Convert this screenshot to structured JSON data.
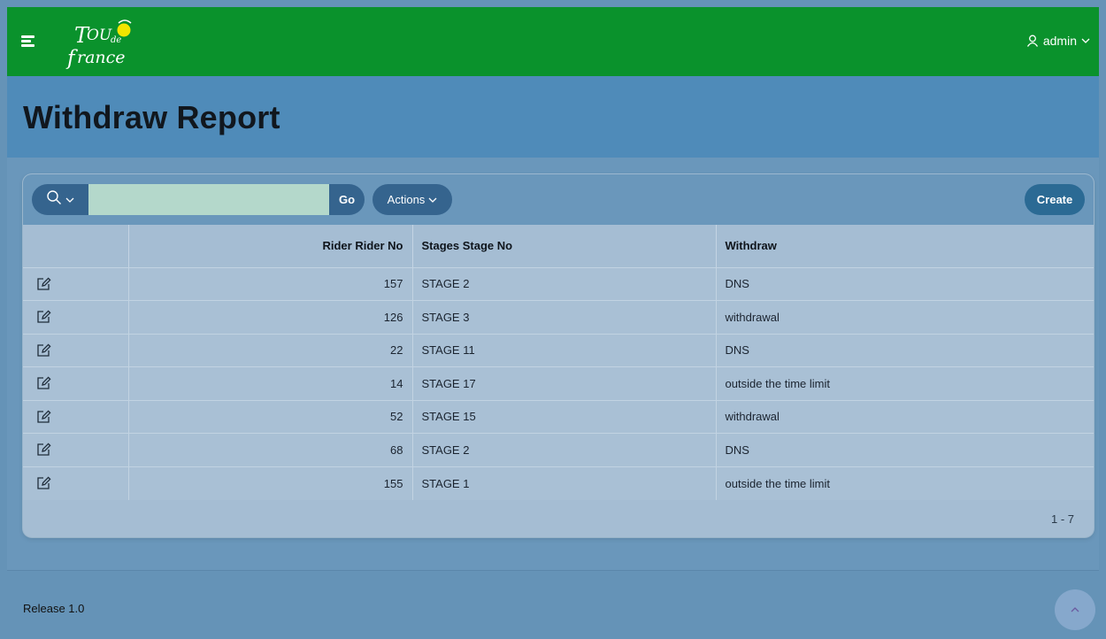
{
  "header": {
    "logo_alt": "Tour de France",
    "user_label": "admin"
  },
  "page": {
    "title": "Withdraw Report"
  },
  "toolbar": {
    "go_label": "Go",
    "actions_label": "Actions",
    "create_label": "Create",
    "search_value": ""
  },
  "table": {
    "columns": [
      "",
      "Rider Rider No",
      "Stages Stage No",
      "Withdraw"
    ],
    "rows": [
      {
        "rider_no": "157",
        "stage": "STAGE 2",
        "withdraw": "DNS"
      },
      {
        "rider_no": "126",
        "stage": "STAGE 3",
        "withdraw": "withdrawal"
      },
      {
        "rider_no": "22",
        "stage": "STAGE 11",
        "withdraw": "DNS"
      },
      {
        "rider_no": "14",
        "stage": "STAGE 17",
        "withdraw": "outside the time limit"
      },
      {
        "rider_no": "52",
        "stage": "STAGE 15",
        "withdraw": "withdrawal"
      },
      {
        "rider_no": "68",
        "stage": "STAGE 2",
        "withdraw": "DNS"
      },
      {
        "rider_no": "155",
        "stage": "STAGE 1",
        "withdraw": "outside the time limit"
      }
    ],
    "pagination": "1 - 7"
  },
  "footer": {
    "release": "Release 1.0"
  },
  "icons": {
    "menu": "hamburger-icon",
    "user": "user-icon",
    "search": "search-icon",
    "chevron": "chevron-down-icon",
    "edit": "edit-icon",
    "scroll_top": "chevron-up-icon"
  },
  "colors": {
    "brand_green": "#0a922c",
    "title_band": "#4f8bb9",
    "content": "#6a97bb",
    "region": "#a5bdd3",
    "button": "#35648e",
    "search_input": "#b4d8cb",
    "logo_yellow": "#f2e500"
  }
}
